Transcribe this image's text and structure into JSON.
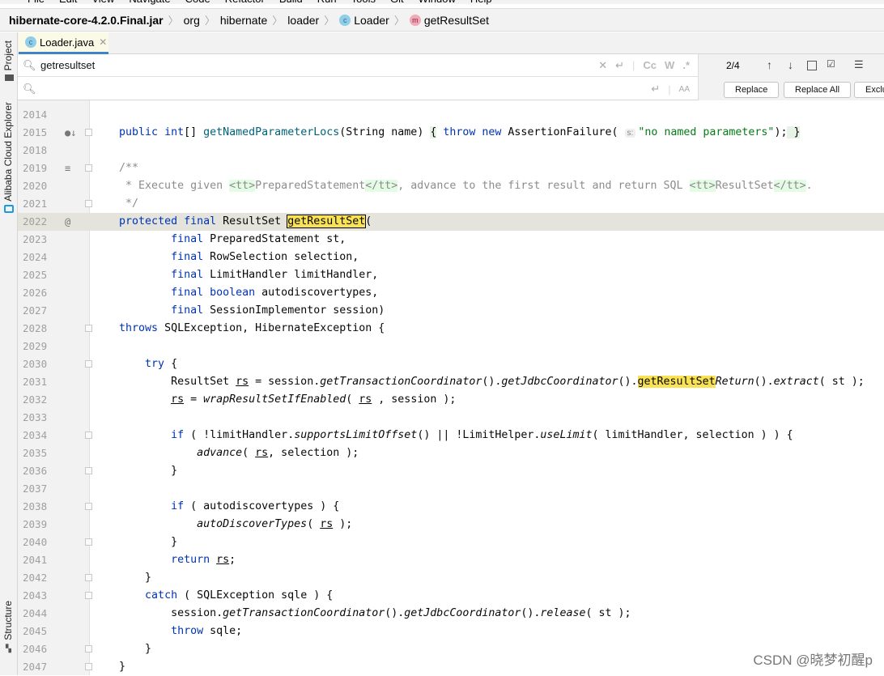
{
  "menu": [
    "File",
    "Edit",
    "View",
    "Navigate",
    "Code",
    "Refactor",
    "Build",
    "Run",
    "Tools",
    "Git",
    "Window",
    "Help"
  ],
  "breadcrumb": [
    "hibernate-core-4.2.0.Final.jar",
    "org",
    "hibernate",
    "loader",
    "Loader",
    "getResultSet"
  ],
  "tab": {
    "label": "Loader.java"
  },
  "side": {
    "project": "Project",
    "alibaba": "Alibaba Cloud Explorer",
    "structure": "Structure"
  },
  "find": {
    "search_value": "getresultset",
    "replace_value": "",
    "match_count": "2/4",
    "replace": "Replace",
    "replace_all": "Replace All",
    "exclude": "Exclude",
    "case": "Cc",
    "words": "W",
    "regex": ".*"
  },
  "watermark": "CSDN @晓梦初醒p",
  "lines": [
    {
      "n": "2014",
      "t": []
    },
    {
      "n": "2015",
      "g": "●↓",
      "fold": true,
      "t": [
        [
          "",
          "    "
        ],
        [
          "k",
          "public int"
        ],
        [
          "",
          "[] "
        ],
        [
          "f",
          "getNamedParameterLocs"
        ],
        [
          "",
          "(String name) "
        ],
        [
          "b",
          "{"
        ],
        [
          "",
          " "
        ],
        [
          "k",
          "throw new "
        ],
        [
          "",
          "AssertionFailure( "
        ],
        [
          "h",
          "s:"
        ],
        [
          "s",
          "\"no named parameters\""
        ],
        [
          "",
          ");"
        ],
        [
          "b",
          " }"
        ]
      ]
    },
    {
      "n": "2018",
      "t": []
    },
    {
      "n": "2019",
      "g": "≡",
      "fold": true,
      "t": [
        [
          "c",
          "    /**"
        ]
      ]
    },
    {
      "n": "2020",
      "t": [
        [
          "c",
          "     * Execute given "
        ],
        [
          "t",
          "<tt>"
        ],
        [
          "c",
          "PreparedStatement"
        ],
        [
          "t",
          "</tt>"
        ],
        [
          "c",
          ", advance to the first result and return SQL "
        ],
        [
          "t",
          "<tt>"
        ],
        [
          "c",
          "ResultSet"
        ],
        [
          "t",
          "</tt>"
        ],
        [
          "c",
          "."
        ]
      ]
    },
    {
      "n": "2021",
      "fold": true,
      "t": [
        [
          "c",
          "     */"
        ]
      ]
    },
    {
      "n": "2022",
      "g": "@",
      "cur": true,
      "t": [
        [
          "",
          "    "
        ],
        [
          "k",
          "protected final "
        ],
        [
          "",
          "ResultSet "
        ],
        [
          "mb",
          "getResultSet"
        ],
        [
          "",
          "("
        ]
      ]
    },
    {
      "n": "2023",
      "t": [
        [
          "",
          "            "
        ],
        [
          "k",
          "final "
        ],
        [
          "",
          "PreparedStatement st,"
        ]
      ]
    },
    {
      "n": "2024",
      "t": [
        [
          "",
          "            "
        ],
        [
          "k",
          "final "
        ],
        [
          "",
          "RowSelection selection,"
        ]
      ]
    },
    {
      "n": "2025",
      "t": [
        [
          "",
          "            "
        ],
        [
          "k",
          "final "
        ],
        [
          "",
          "LimitHandler limitHandler,"
        ]
      ]
    },
    {
      "n": "2026",
      "t": [
        [
          "",
          "            "
        ],
        [
          "k",
          "final boolean "
        ],
        [
          "",
          "autodiscovertypes,"
        ]
      ]
    },
    {
      "n": "2027",
      "t": [
        [
          "",
          "            "
        ],
        [
          "k",
          "final "
        ],
        [
          "",
          "SessionImplementor session)"
        ]
      ]
    },
    {
      "n": "2028",
      "fold": true,
      "t": [
        [
          "",
          "    "
        ],
        [
          "k",
          "throws "
        ],
        [
          "",
          "SQLException, HibernateException {"
        ]
      ]
    },
    {
      "n": "2029",
      "t": []
    },
    {
      "n": "2030",
      "fold": true,
      "t": [
        [
          "",
          "        "
        ],
        [
          "k",
          "try "
        ],
        [
          "",
          "{"
        ]
      ]
    },
    {
      "n": "2031",
      "t": [
        [
          "",
          "            ResultSet "
        ],
        [
          "u",
          "rs"
        ],
        [
          "",
          " = session."
        ],
        [
          "i",
          "getTransactionCoordinator"
        ],
        [
          "",
          "()."
        ],
        [
          "i",
          "getJdbcCoordinator"
        ],
        [
          "",
          "()."
        ],
        [
          "m",
          "getResultSet"
        ],
        [
          "i",
          "Return"
        ],
        [
          "",
          "()."
        ],
        [
          "i",
          "extract"
        ],
        [
          "",
          "( st );"
        ]
      ]
    },
    {
      "n": "2032",
      "t": [
        [
          "",
          "            "
        ],
        [
          "u",
          "rs"
        ],
        [
          "",
          " = "
        ],
        [
          "i",
          "wrapResultSetIfEnabled"
        ],
        [
          "",
          "( "
        ],
        [
          "u",
          "rs"
        ],
        [
          "",
          " , session );"
        ]
      ]
    },
    {
      "n": "2033",
      "t": []
    },
    {
      "n": "2034",
      "fold": true,
      "t": [
        [
          "",
          "            "
        ],
        [
          "k",
          "if "
        ],
        [
          "",
          "( !limitHandler."
        ],
        [
          "i",
          "supportsLimitOffset"
        ],
        [
          "",
          "() || !LimitHelper."
        ],
        [
          "i",
          "useLimit"
        ],
        [
          "",
          "( limitHandler, selection ) ) {"
        ]
      ]
    },
    {
      "n": "2035",
      "t": [
        [
          "",
          "                "
        ],
        [
          "i",
          "advance"
        ],
        [
          "",
          "( "
        ],
        [
          "u",
          "rs"
        ],
        [
          "",
          ", selection );"
        ]
      ]
    },
    {
      "n": "2036",
      "fold": true,
      "t": [
        [
          "",
          "            }"
        ]
      ]
    },
    {
      "n": "2037",
      "t": []
    },
    {
      "n": "2038",
      "fold": true,
      "t": [
        [
          "",
          "            "
        ],
        [
          "k",
          "if "
        ],
        [
          "",
          "( autodiscovertypes ) {"
        ]
      ]
    },
    {
      "n": "2039",
      "t": [
        [
          "",
          "                "
        ],
        [
          "i",
          "autoDiscoverTypes"
        ],
        [
          "",
          "( "
        ],
        [
          "u",
          "rs"
        ],
        [
          "",
          " );"
        ]
      ]
    },
    {
      "n": "2040",
      "fold": true,
      "t": [
        [
          "",
          "            }"
        ]
      ]
    },
    {
      "n": "2041",
      "t": [
        [
          "",
          "            "
        ],
        [
          "k",
          "return "
        ],
        [
          "u",
          "rs"
        ],
        [
          "",
          ";"
        ]
      ]
    },
    {
      "n": "2042",
      "fold": true,
      "t": [
        [
          "",
          "        }"
        ]
      ]
    },
    {
      "n": "2043",
      "fold": true,
      "t": [
        [
          "",
          "        "
        ],
        [
          "k",
          "catch "
        ],
        [
          "",
          "( SQLException sqle ) {"
        ]
      ]
    },
    {
      "n": "2044",
      "t": [
        [
          "",
          "            session."
        ],
        [
          "i",
          "getTransactionCoordinator"
        ],
        [
          "",
          "()."
        ],
        [
          "i",
          "getJdbcCoordinator"
        ],
        [
          "",
          "()."
        ],
        [
          "i",
          "release"
        ],
        [
          "",
          "( st );"
        ]
      ]
    },
    {
      "n": "2045",
      "t": [
        [
          "",
          "            "
        ],
        [
          "k",
          "throw "
        ],
        [
          "",
          "sqle;"
        ]
      ]
    },
    {
      "n": "2046",
      "fold": true,
      "t": [
        [
          "",
          "        }"
        ]
      ]
    },
    {
      "n": "2047",
      "fold": true,
      "t": [
        [
          "",
          "    }"
        ]
      ]
    }
  ]
}
